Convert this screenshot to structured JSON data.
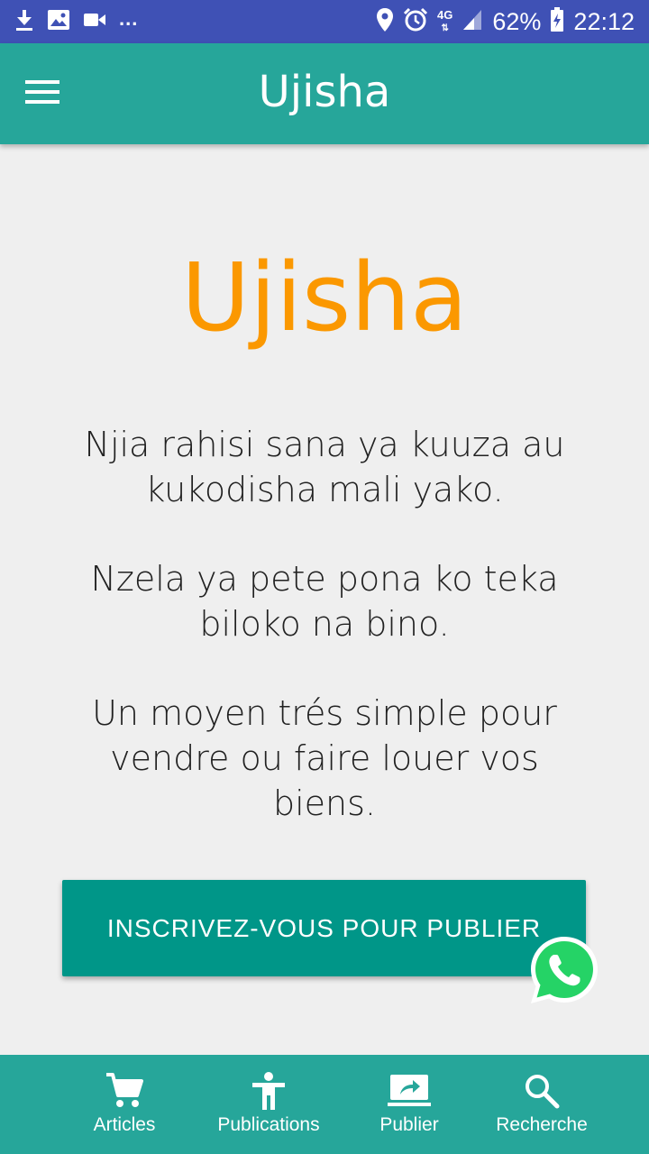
{
  "status_bar": {
    "network": "4G",
    "battery": "62%",
    "time": "22:12",
    "overflow": "...",
    "icons": [
      "download-icon",
      "image-icon",
      "video-icon",
      "location-icon",
      "alarm-icon",
      "network-icon",
      "signal-icon",
      "battery-charging-icon"
    ]
  },
  "app_bar": {
    "title": "Ujisha",
    "menu_icon": "hamburger-menu-icon"
  },
  "main": {
    "brand_title": "Ujisha",
    "tagline_sw": "Njia rahisi sana ya kuuza au kukodisha mali yako.",
    "tagline_ln": "Nzela ya pete pona ko teka biloko na bino.",
    "tagline_fr": "Un moyen trés simple pour vendre ou faire louer vos biens.",
    "cta_label": "INSCRIVEZ-VOUS POUR PUBLIER"
  },
  "fab": {
    "icon": "whatsapp-icon"
  },
  "bottom_nav": {
    "items": [
      {
        "label": "Articles",
        "icon": "cart-icon"
      },
      {
        "label": "Publications",
        "icon": "person-icon"
      },
      {
        "label": "Publier",
        "icon": "share-icon"
      },
      {
        "label": "Recherche",
        "icon": "search-icon"
      }
    ]
  },
  "colors": {
    "status_bar": "#3f51b5",
    "app_bar": "#26a69a",
    "brand_orange": "#fb9800",
    "button": "#009688",
    "background": "#efefef",
    "whatsapp": "#25d366"
  }
}
